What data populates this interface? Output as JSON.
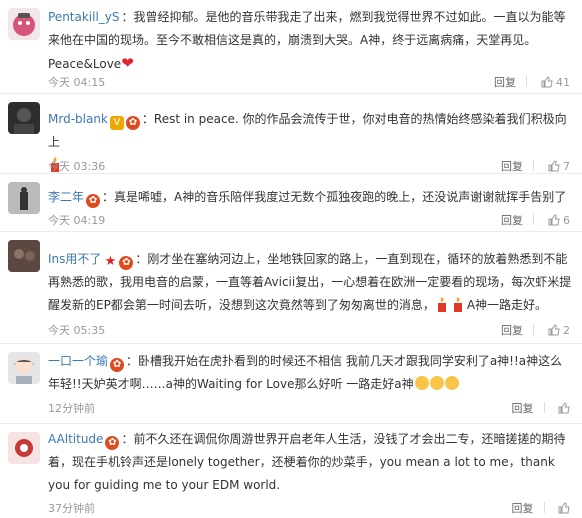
{
  "comments": [
    {
      "user": "Pentakill_yS",
      "text": "：我曾经抑郁。是他的音乐带我走了出来，燃到我觉得世界不过如此。一直以为能等来他在中国的现场。至今不敢相信这是真的，崩溃到大哭。A神，终于远离病痛，天堂再见。Peace&Love",
      "time": "今天 04:15",
      "likes": "41",
      "reply": "回复",
      "avatar_color": "#d8557a"
    },
    {
      "user": "Mrd-blank",
      "text": "：Rest in peace. 你的作品会流传于世，你对电音的热情始终感染着我们积极向上",
      "time": "今天 03:36",
      "likes": "7",
      "reply": "回复",
      "avatar_color": "#3a3a3a"
    },
    {
      "user": "李二年",
      "text": "：真是唏嘘，A神的音乐陪伴我度过无数个孤独夜跑的晚上，还没说声谢谢就挥手告别了",
      "time": "今天 04:19",
      "likes": "6",
      "reply": "回复",
      "avatar_color": "#6b6b6b"
    },
    {
      "user": "Ins用不了",
      "text": "：刚才坐在塞纳河边上，坐地铁回家的路上，一直到现在，循环的放着熟悉到不能再熟悉的歌，我用电音的启蒙，一直等着Avicii复出，一心想着在欧洲一定要看的现场，每次虾米提醒发新的EP都会第一时间去听，没想到这次竟然等到了匆匆离世的消息，",
      "text_tail": "A神一路走好。",
      "time": "今天 05:35",
      "likes": "2",
      "reply": "回复",
      "avatar_color": "#4a3b36"
    },
    {
      "user": "一口一个瑜",
      "text": "：卧槽我开始在虎扑看到的时候还不相信 我前几天才跟我同学安利了a神!!a神这么年轻!!天妒英才啊……a神的Waiting for Love那么好听 一路走好a神",
      "time": "12分钟前",
      "likes": "",
      "reply": "回复",
      "avatar_color": "#9aa0a8"
    },
    {
      "user": "AAltitude",
      "text": "：前不久还在调侃你周游世界开启老年人生活，没钱了才会出二专，还暗搓搓的期待着，现在手机铃声还是lonely together，还梗着你的炒菜手，you mean a  lot to me，thank you for guiding me to your EDM world.",
      "time": "37分钟前",
      "likes": "",
      "reply": "回复",
      "avatar_color": "#c23a3a"
    }
  ],
  "colors": {
    "username": "#3c78b5",
    "meta": "#999999",
    "divider": "#ececec"
  },
  "icons": {
    "like": "thumbs-up-icon",
    "share": "share-icon",
    "vip": "v-badge-icon",
    "medal": "medal-badge-icon"
  }
}
